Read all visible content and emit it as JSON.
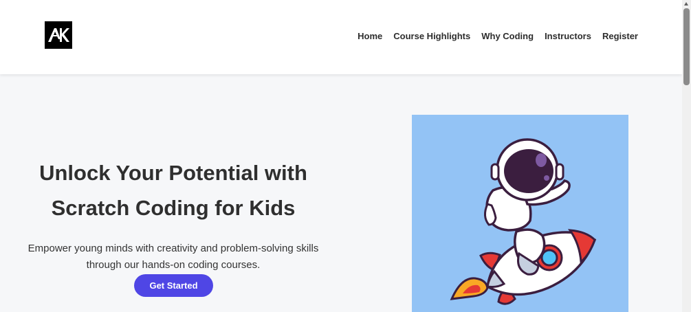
{
  "brand": {
    "logo_text": "AK"
  },
  "nav": {
    "items": [
      {
        "label": "Home"
      },
      {
        "label": "Course Highlights"
      },
      {
        "label": "Why Coding"
      },
      {
        "label": "Instructors"
      },
      {
        "label": "Register"
      }
    ]
  },
  "hero": {
    "title_line1": "Unlock Your Potential with",
    "title_line2": "Scratch Coding for Kids",
    "subtitle_line1": "Empower young minds with creativity and problem-solving skills",
    "subtitle_line2": "through our hands-on coding courses.",
    "cta_label": "Get Started",
    "image_icon": "astronaut-on-rocket-illustration"
  },
  "colors": {
    "accent": "#4f46e5",
    "image_bg": "#93c3f5",
    "text": "#2f2f2f"
  }
}
